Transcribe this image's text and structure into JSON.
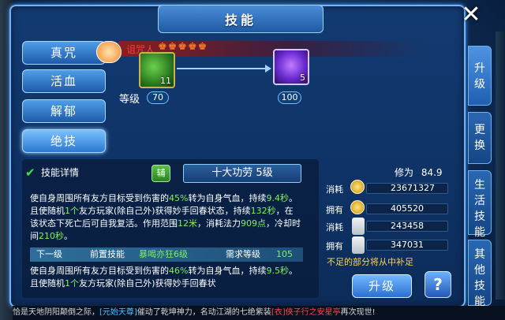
{
  "window": {
    "title": "技能",
    "close_icon": "close-icon"
  },
  "skills": [
    {
      "label": "真咒"
    },
    {
      "label": "活血"
    },
    {
      "label": "解郁"
    },
    {
      "label": "绝技"
    }
  ],
  "progression": {
    "banner_name": "诅咒人",
    "banner_crowns": "♚♚♚♚♚",
    "current_icon_count": "11",
    "next_icon_count": "5",
    "level_label": "等级",
    "current_level": "70",
    "next_level": "100"
  },
  "details": {
    "header": "技能详情",
    "tag": "辅",
    "stage": "十大功劳 5级",
    "desc1_a": "使自身周围所有友方目标受到伤害的",
    "desc1_pct": "45%",
    "desc1_b": "转为自身气血，持续",
    "desc1_sec": "9.4秒",
    "desc1_c": "。且使随机",
    "desc1_n": "1个",
    "desc1_d": "友方玩家(除自己外)获得妙手回春状态，持续",
    "desc1_dur": "132秒",
    "desc1_e": "，在该状态下死亡后可自我复活。作用范围",
    "desc1_r": "12米",
    "desc1_f": "，消耗法力",
    "desc1_mana": "909点",
    "desc1_g": "，冷却时间",
    "desc1_cd": "210秒",
    "desc1_h": "。",
    "next_label": "下一级",
    "prereq_label": "前置技能",
    "prereq_value": "暴喝亦狂6级",
    "req_label": "需求等级",
    "req_value": "105",
    "desc2_a": "使自身周围所有友方目标受到伤害的",
    "desc2_pct": "46%",
    "desc2_b": "转为自身气血，持续",
    "desc2_sec": "9.5秒",
    "desc2_c": "。且使随机",
    "desc2_n": "1个",
    "desc2_d": "友方玩家(除自己外)获得妙手回春状"
  },
  "stats": {
    "cultivation_label": "修为",
    "cultivation_value": "84.9",
    "rows": [
      {
        "label": "消耗",
        "icon": "gold-coin-icon",
        "value": "23671327"
      },
      {
        "label": "拥有",
        "icon": "gold-coin-icon",
        "value": "405520"
      },
      {
        "label": "消耗",
        "icon": "scroll-icon",
        "value": "243458"
      },
      {
        "label": "拥有",
        "icon": "scroll-icon",
        "value": "347031"
      }
    ],
    "note": "不足的部分将从中补足",
    "upgrade_label": "升级",
    "help_label": "?"
  },
  "side_tabs": [
    {
      "label": "升级"
    },
    {
      "label": "更换"
    },
    {
      "label": "生活技能"
    },
    {
      "label": "其他技能"
    }
  ],
  "ticker": {
    "a": "恰是天地阴阳颠倒之际，",
    "b": "[元始天尊]",
    "c": "催动了乾坤神力，名动江湖的七绝紫装",
    "d": "[衣]俠子行之安星亭",
    "e": "再次现世!"
  }
}
